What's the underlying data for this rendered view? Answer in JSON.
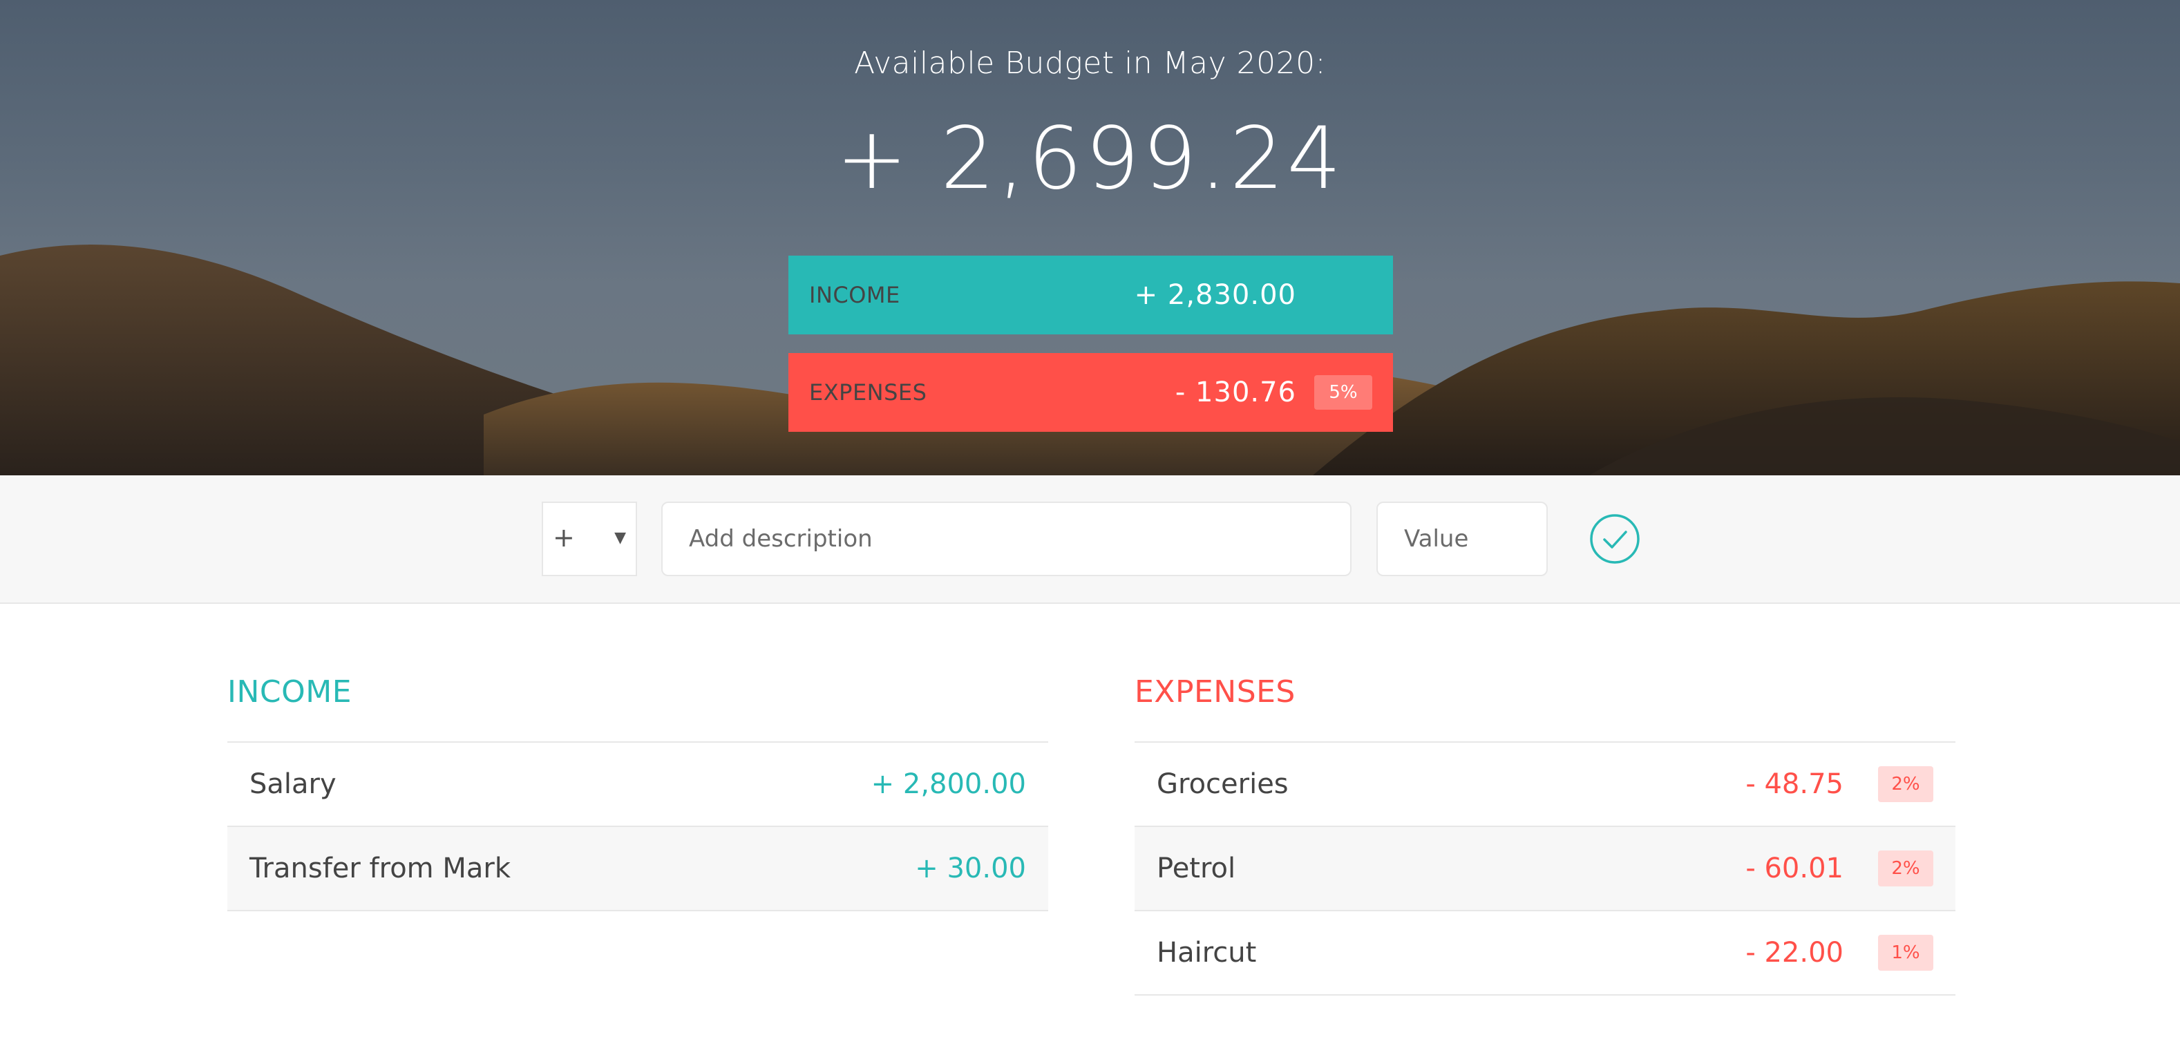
{
  "budget": {
    "title": "Available Budget in May 2020:",
    "value": "+ 2,699.24",
    "income": {
      "label": "INCOME",
      "value": "+ 2,830.00"
    },
    "expenses": {
      "label": "EXPENSES",
      "value": "- 130.76",
      "percentage": "5%"
    }
  },
  "add": {
    "type_symbol": "+",
    "description_placeholder": "Add description",
    "value_placeholder": "Value"
  },
  "income": {
    "title": "INCOME",
    "items": [
      {
        "description": "Salary",
        "value": "+ 2,800.00"
      },
      {
        "description": "Transfer from Mark",
        "value": "+ 30.00"
      }
    ]
  },
  "expenses": {
    "title": "EXPENSES",
    "items": [
      {
        "description": "Groceries",
        "value": "- 48.75",
        "percentage": "2%"
      },
      {
        "description": "Petrol",
        "value": "- 60.01",
        "percentage": "2%"
      },
      {
        "description": "Haircut",
        "value": "- 22.00",
        "percentage": "1%"
      }
    ]
  },
  "colors": {
    "income": "#28b9b5",
    "expense": "#ff5049",
    "expense_badge_bg": "#ffdad9"
  },
  "icons": {
    "submit": "checkmark-circle-icon",
    "type_caret": "caret-down-icon"
  }
}
